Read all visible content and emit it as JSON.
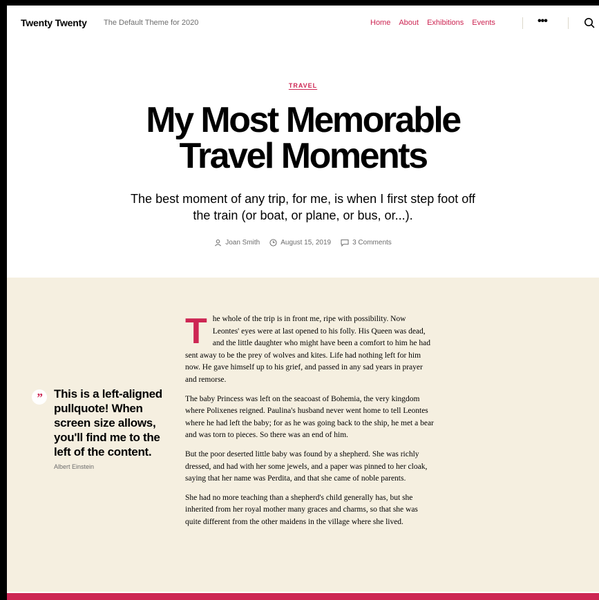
{
  "header": {
    "site_title": "Twenty Twenty",
    "site_description": "The Default Theme for 2020",
    "nav": [
      "Home",
      "About",
      "Exhibitions",
      "Events"
    ],
    "more_label": "•••"
  },
  "post": {
    "category": "TRAVEL",
    "title_line1": "My Most Memorable",
    "title_line2": "Travel Moments",
    "subtitle": "The best moment of any trip, for me, is when I first step foot off the train (or boat, or plane, or bus, or...).",
    "author": "Joan Smith",
    "date": "August 15, 2019",
    "comments": "3 Comments"
  },
  "pullquote": {
    "text": "This is a left-aligned pullquote! When screen size allows, you'll find me to the left of the content.",
    "cite": "Albert Einstein"
  },
  "body": {
    "dropcap": "T",
    "p1": "he whole of the trip is in front me, ripe with possibility. Now Leontes' eyes were at last opened to his folly. His Queen was dead, and the little daughter who might have been a comfort to him he had sent away to be the prey of wolves and kites. Life had nothing left for him now. He gave himself up to his grief, and passed in any sad years in prayer and remorse.",
    "p2": "The baby Princess was left on the seacoast of Bohemia, the very kingdom where Polixenes reigned. Paulina's husband never went home to tell Leontes where he had left the baby; for as he was going back to the ship, he met a bear and was torn to pieces. So there was an end of him.",
    "p3": "But the poor deserted little baby was found by a shepherd. She was richly dressed, and had with her some jewels, and a paper was pinned to her cloak, saying that her name was Perdita, and that she came of noble parents.",
    "p4": "She had no more teaching than a shepherd's child generally has, but she inherited from her royal mother many graces and charms, so that she was quite different from the other maidens in the village where she lived."
  },
  "colors": {
    "accent": "#cd2653",
    "content_bg": "#f5efe0",
    "secondary_text": "#6d6d6d"
  },
  "icons": [
    "search-icon",
    "user-icon",
    "clock-icon",
    "comment-icon",
    "quote-icon"
  ]
}
